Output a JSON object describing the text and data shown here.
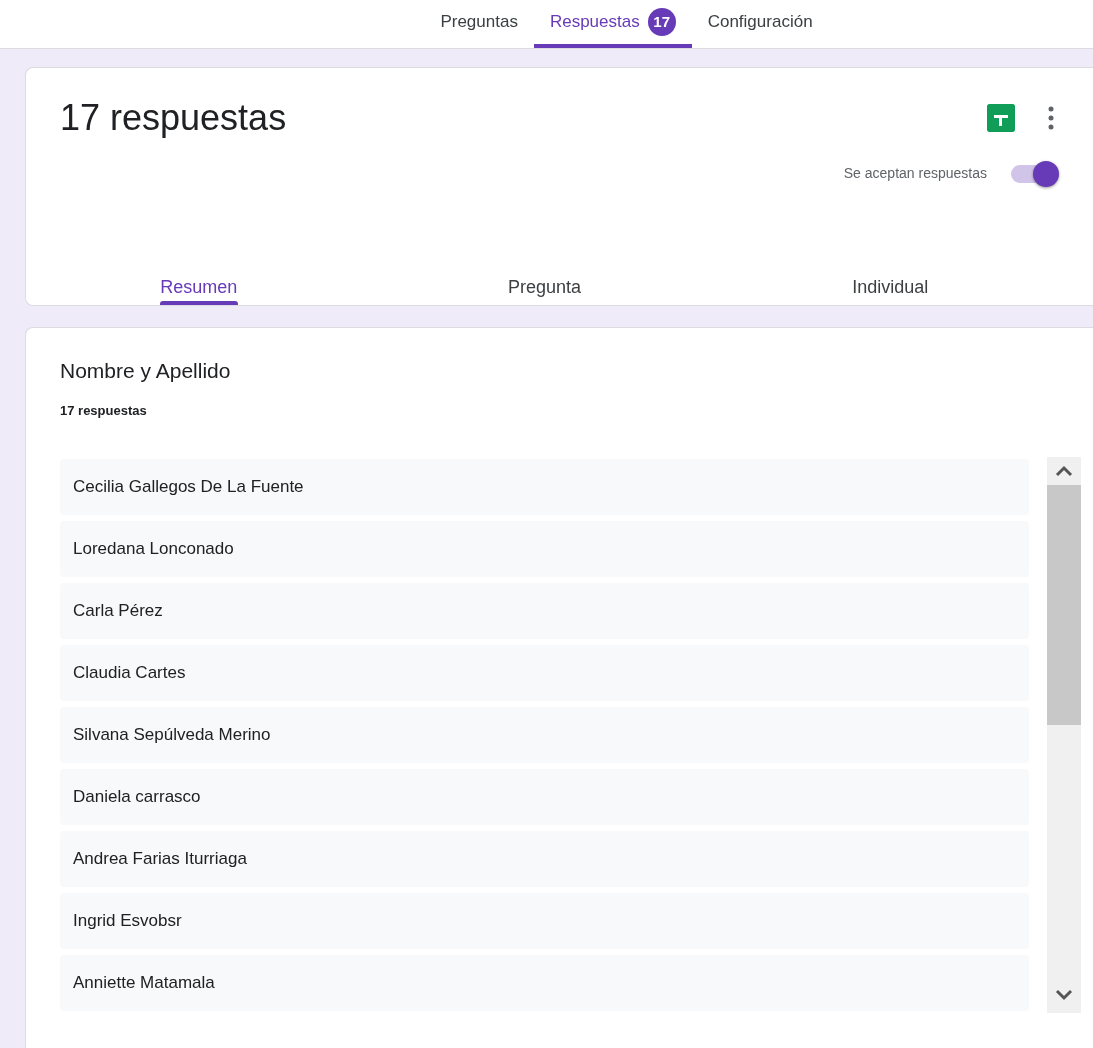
{
  "top_tabs": [
    {
      "label": "Preguntas",
      "selected": false
    },
    {
      "label": "Respuestas",
      "selected": true,
      "badge": "17"
    },
    {
      "label": "Configuración",
      "selected": false
    }
  ],
  "summary": {
    "title": "17 respuestas",
    "toggle": {
      "label": "Se aceptan respuestas",
      "on": true
    },
    "tabs": [
      {
        "label": "Resumen",
        "selected": true
      },
      {
        "label": "Pregunta",
        "selected": false
      },
      {
        "label": "Individual",
        "selected": false
      }
    ]
  },
  "question": {
    "title": "Nombre y Apellido",
    "count": "17 respuestas",
    "answers": [
      "Cecilia Gallegos De La Fuente",
      "Loredana Lonconado",
      "Carla Pérez",
      "Claudia Cartes",
      "Silvana Sepúlveda Merino",
      "Daniela carrasco",
      "Andrea Farias Iturriaga",
      "Ingrid Esvobsr",
      "Anniette Matamala"
    ]
  }
}
